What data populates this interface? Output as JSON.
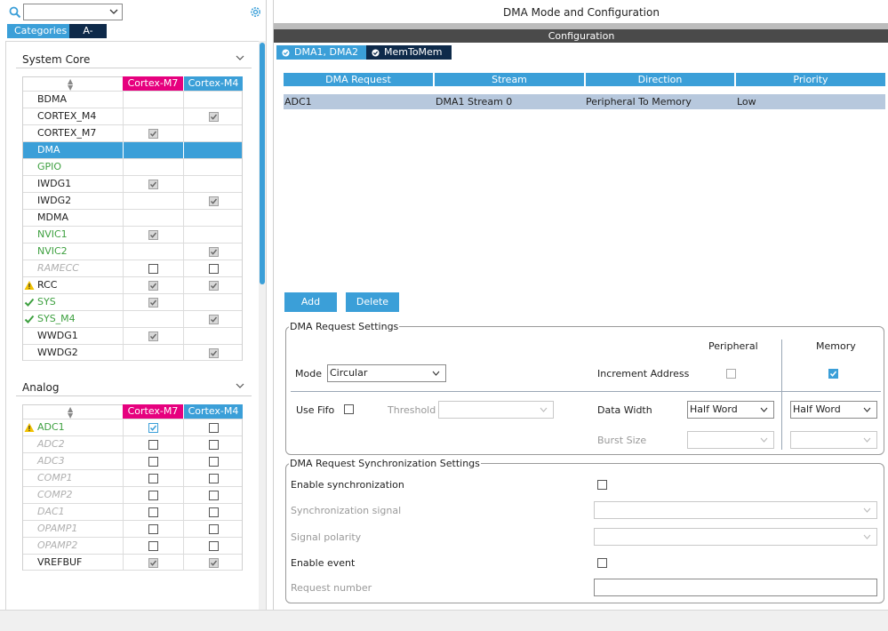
{
  "left": {
    "search_value": "",
    "tabs": {
      "categories": "Categories",
      "az": "A->Z"
    },
    "system_core": {
      "title": "System Core",
      "col_m7": "Cortex-M7",
      "col_m4": "Cortex-M4",
      "rows": [
        {
          "name": "BDMA",
          "style": "normal",
          "m7": "none",
          "m4": "none"
        },
        {
          "name": "CORTEX_M4",
          "style": "normal",
          "m7": "none",
          "m4": "checked-gray"
        },
        {
          "name": "CORTEX_M7",
          "style": "normal",
          "m7": "checked-gray",
          "m4": "none"
        },
        {
          "name": "DMA",
          "style": "selected",
          "m7": "none",
          "m4": "none"
        },
        {
          "name": "GPIO",
          "style": "green",
          "m7": "none",
          "m4": "none"
        },
        {
          "name": "IWDG1",
          "style": "normal",
          "m7": "checked-gray",
          "m4": "none"
        },
        {
          "name": "IWDG2",
          "style": "normal",
          "m7": "none",
          "m4": "checked-gray"
        },
        {
          "name": "MDMA",
          "style": "normal",
          "m7": "none",
          "m4": "none"
        },
        {
          "name": "NVIC1",
          "style": "green",
          "m7": "checked-gray",
          "m4": "none"
        },
        {
          "name": "NVIC2",
          "style": "green",
          "m7": "none",
          "m4": "checked-gray"
        },
        {
          "name": "RAMECC",
          "style": "disabled",
          "m7": "unchecked",
          "m4": "unchecked"
        },
        {
          "name": "RCC",
          "style": "normal",
          "icon": "warning-icon",
          "m7": "checked-gray",
          "m4": "checked-gray"
        },
        {
          "name": "SYS",
          "style": "green",
          "icon": "check-icon",
          "m7": "checked-gray",
          "m4": "none"
        },
        {
          "name": "SYS_M4",
          "style": "green",
          "icon": "check-icon",
          "m7": "none",
          "m4": "checked-gray"
        },
        {
          "name": "WWDG1",
          "style": "normal",
          "m7": "checked-gray",
          "m4": "none"
        },
        {
          "name": "WWDG2",
          "style": "normal",
          "m7": "none",
          "m4": "checked-gray"
        }
      ]
    },
    "analog": {
      "title": "Analog",
      "col_m7": "Cortex-M7",
      "col_m4": "Cortex-M4",
      "rows": [
        {
          "name": "ADC1",
          "style": "green",
          "icon": "warning-icon",
          "m7": "checked-blue",
          "m4": "unchecked"
        },
        {
          "name": "ADC2",
          "style": "disabled",
          "m7": "unchecked",
          "m4": "unchecked"
        },
        {
          "name": "ADC3",
          "style": "disabled",
          "m7": "unchecked",
          "m4": "unchecked"
        },
        {
          "name": "COMP1",
          "style": "disabled",
          "m7": "unchecked",
          "m4": "unchecked"
        },
        {
          "name": "COMP2",
          "style": "disabled",
          "m7": "unchecked",
          "m4": "unchecked"
        },
        {
          "name": "DAC1",
          "style": "disabled",
          "m7": "unchecked",
          "m4": "unchecked"
        },
        {
          "name": "OPAMP1",
          "style": "disabled",
          "m7": "unchecked",
          "m4": "unchecked"
        },
        {
          "name": "OPAMP2",
          "style": "disabled",
          "m7": "unchecked",
          "m4": "unchecked"
        },
        {
          "name": "VREFBUF",
          "style": "normal",
          "m7": "checked-gray",
          "m4": "checked-gray"
        }
      ]
    }
  },
  "right": {
    "title": "DMA Mode and Configuration",
    "config_label": "Configuration",
    "tabs": [
      "DMA1, DMA2",
      "MemToMem"
    ],
    "table": {
      "headers": [
        "DMA Request",
        "Stream",
        "Direction",
        "Priority"
      ],
      "rows": [
        [
          "ADC1",
          "DMA1 Stream 0",
          "Peripheral To Memory",
          "Low"
        ]
      ]
    },
    "buttons": {
      "add": "Add",
      "delete": "Delete"
    },
    "request_settings": {
      "legend": "DMA Request Settings",
      "peripheral_label": "Peripheral",
      "memory_label": "Memory",
      "mode_label": "Mode",
      "mode_value": "Circular",
      "increment_label": "Increment Address",
      "use_fifo_label": "Use Fifo",
      "threshold_label": "Threshold",
      "threshold_value": "",
      "data_width_label": "Data Width",
      "periph_width": "Half Word",
      "mem_width": "Half Word",
      "burst_label": "Burst Size",
      "periph_burst": "",
      "mem_burst": ""
    },
    "sync_settings": {
      "legend": "DMA Request Synchronization Settings",
      "enable_sync_label": "Enable synchronization",
      "sync_signal_label": "Synchronization signal",
      "sync_signal_value": "",
      "signal_polarity_label": "Signal polarity",
      "signal_polarity_value": "",
      "enable_event_label": "Enable event",
      "request_number_label": "Request number",
      "request_number_value": ""
    }
  },
  "colors": {
    "accent": "#3b9fd8",
    "navy": "#0e2a4a",
    "m7": "#e6007e",
    "green": "#3ea040",
    "selection": "#b7c8dd"
  }
}
